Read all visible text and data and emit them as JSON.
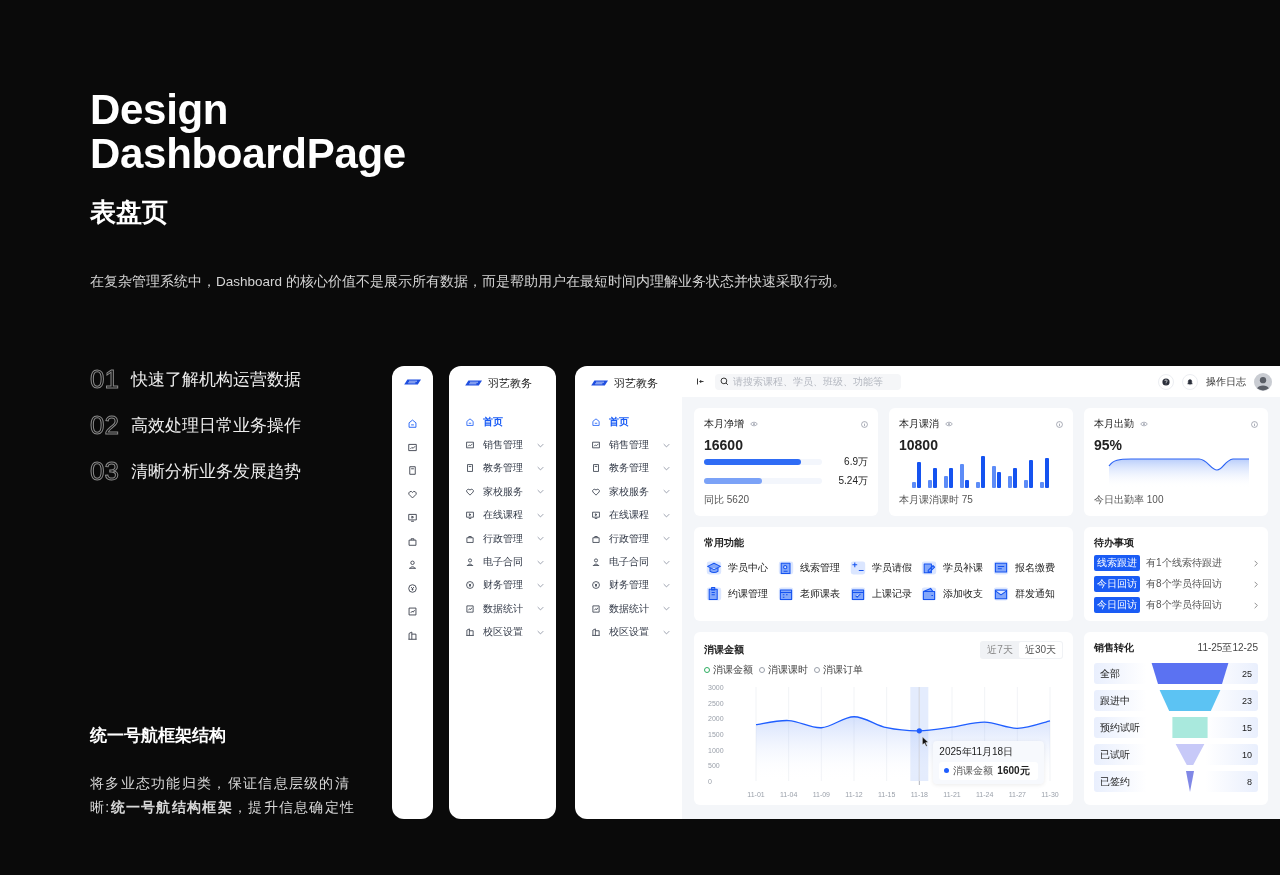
{
  "hero": {
    "title_lines": [
      "Design",
      "DashboardPage"
    ],
    "subtitle": "表盘页",
    "description": "在复杂管理系统中，Dashboard 的核心价值不是展示所有数据，而是帮助用户在最短时间内理解业务状态并快速采取行动。"
  },
  "points": [
    {
      "number": "01",
      "text": "快速了解机构运营数据"
    },
    {
      "number": "02",
      "text": "高效处理日常业务操作"
    },
    {
      "number": "03",
      "text": "清晰分析业务发展趋势"
    }
  ],
  "section": {
    "title": "统一号航框架结构",
    "body": "将多业态功能归类，保证信息层级的清晰:**统一号航结构框架**，提升信息确定性"
  },
  "nav_rail": {
    "items": [
      {
        "selected": true
      },
      {
        "selected": false
      },
      {
        "selected": false
      },
      {
        "selected": false
      },
      {
        "selected": false
      },
      {
        "selected": false
      },
      {
        "selected": false
      },
      {
        "selected": false
      },
      {
        "selected": false
      },
      {
        "selected": false
      }
    ]
  },
  "nav_panel": {
    "brand": "羽艺教务",
    "items": [
      {
        "label": "首页",
        "selected": true,
        "expandable": false
      },
      {
        "label": "销售管理",
        "selected": false,
        "expandable": true
      },
      {
        "label": "教务管理",
        "selected": false,
        "expandable": true
      },
      {
        "label": "家校服务",
        "selected": false,
        "expandable": true
      },
      {
        "label": "在线课程",
        "selected": false,
        "expandable": true
      },
      {
        "label": "行政管理",
        "selected": false,
        "expandable": true
      },
      {
        "label": "电子合同",
        "selected": false,
        "expandable": true
      },
      {
        "label": "财务管理",
        "selected": false,
        "expandable": true
      },
      {
        "label": "数据统计",
        "selected": false,
        "expandable": true
      },
      {
        "label": "校区设置",
        "selected": false,
        "expandable": true
      }
    ]
  },
  "dashboard": {
    "nav": {
      "brand": "羽艺教务",
      "items": [
        {
          "label": "首页",
          "selected": true,
          "expandable": false
        },
        {
          "label": "销售管理",
          "selected": false,
          "expandable": true
        },
        {
          "label": "教务管理",
          "selected": false,
          "expandable": true
        },
        {
          "label": "家校服务",
          "selected": false,
          "expandable": true
        },
        {
          "label": "在线课程",
          "selected": false,
          "expandable": true
        },
        {
          "label": "行政管理",
          "selected": false,
          "expandable": true
        },
        {
          "label": "电子合同",
          "selected": false,
          "expandable": true
        },
        {
          "label": "财务管理",
          "selected": false,
          "expandable": true
        },
        {
          "label": "数据统计",
          "selected": false,
          "expandable": true
        },
        {
          "label": "校区设置",
          "selected": false,
          "expandable": true
        }
      ]
    },
    "topbar": {
      "search": {
        "placeholder": "请搜索课程、学员、班级、功能等"
      },
      "log_link": "操作日志"
    },
    "stat_cards": [
      {
        "kind": "progress",
        "title": "本月净增",
        "value": "16600",
        "bars": [
          {
            "level": 0.82,
            "value": "6.9万"
          },
          {
            "level": 0.49,
            "value": "5.24万"
          }
        ],
        "footer": "同比 5620"
      },
      {
        "kind": "columns",
        "title": "本月课消",
        "value": "10800",
        "footer": "本月课消课时  75"
      },
      {
        "kind": "area",
        "title": "本月出勤",
        "value": "95%",
        "footer": "今日出勤率 100"
      }
    ],
    "shortcuts": {
      "title": "常用功能",
      "items": [
        "学员中心",
        "线索管理",
        "学员请假",
        "学员补课",
        "报名缴费",
        "约课管理",
        "老师课表",
        "上课记录",
        "添加收支",
        "群发通知"
      ]
    },
    "todos": {
      "title": "待办事项",
      "items": [
        {
          "tag": "线索跟进",
          "text": "有1个线索待跟进"
        },
        {
          "tag": "今日回访",
          "text": "有8个学员待回访"
        },
        {
          "tag": "今日回访",
          "text": "有8个学员待回访"
        }
      ]
    },
    "trend": {
      "title": "消课金额",
      "ranges": [
        {
          "label": "近7天",
          "selected": false
        },
        {
          "label": "近30天",
          "selected": true
        }
      ],
      "legend": [
        {
          "label": "消课金额",
          "selected": true
        },
        {
          "label": "消课课时",
          "selected": false
        },
        {
          "label": "消课订单",
          "selected": false
        }
      ],
      "chart_data": {
        "type": "area",
        "categories": [
          "11-01",
          "11-04",
          "11-09",
          "11-12",
          "11-15",
          "11-18",
          "11-21",
          "11-24",
          "11-27",
          "11-30"
        ],
        "series": [
          {
            "name": "消课金额",
            "color": "#1f5eff",
            "values": [
              1800,
              1930,
              1700,
              2050,
              1700,
              1600,
              1720,
              1880,
              1680,
              1920
            ]
          }
        ],
        "ylim": [
          0,
          3000
        ],
        "yticks": [
          0,
          500,
          1000,
          1500,
          2000,
          2500,
          3000
        ],
        "grid": true
      },
      "tooltip": {
        "date": "2025年11月18日",
        "value": "1600元"
      }
    },
    "funnel": {
      "title": "销售转化",
      "period": "11-25至12-25",
      "stages": [
        {
          "label": "全部",
          "value": "25",
          "color": "#5b72f2"
        },
        {
          "label": "跟进中",
          "value": "23",
          "color": "#5cc3f3"
        },
        {
          "label": "预约试听",
          "value": "15",
          "color": "#a9e9dd"
        },
        {
          "label": "已试听",
          "value": "10",
          "color": "#c7c9f8"
        },
        {
          "label": "已签约",
          "value": "8",
          "color": "#8088e6"
        }
      ]
    }
  }
}
